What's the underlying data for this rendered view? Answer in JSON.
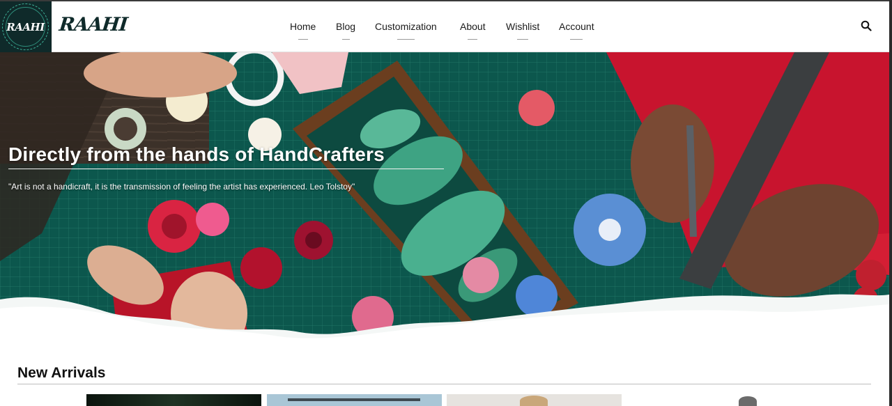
{
  "brand": {
    "badge_text": "RAAHI",
    "name": "RAAHI"
  },
  "nav": {
    "items": [
      {
        "label": "Home"
      },
      {
        "label": "Blog"
      },
      {
        "label": "Customization"
      },
      {
        "label": "About"
      },
      {
        "label": "Wishlist"
      },
      {
        "label": "Account"
      }
    ],
    "search_icon": "search-icon"
  },
  "hero": {
    "title": "Directly from the hands of HandCrafters",
    "quote": "\"Art is not a handicraft, it is the transmission of feeling the artist has experienced. Leo Tolstoy\""
  },
  "new_arrivals": {
    "title": "New Arrivals",
    "products": [
      {
        "thumb_color": "#0f1a12"
      },
      {
        "thumb_color": "#a9c6d6"
      },
      {
        "thumb_color": "#e6e3df"
      },
      {
        "thumb_color": "#ffffff"
      }
    ]
  },
  "colors": {
    "brand_dark": "#0f2a2a",
    "accent_teal": "#3fb39a",
    "text": "#1a1a1a"
  }
}
